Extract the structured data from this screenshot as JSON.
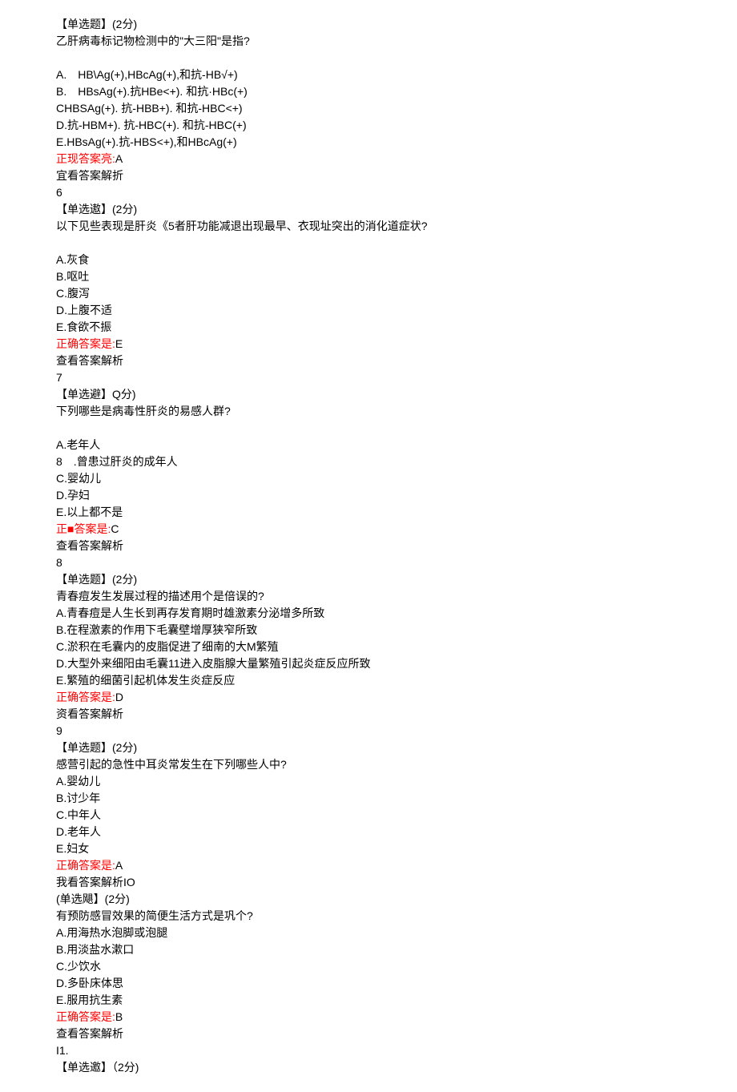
{
  "q5": {
    "header": "【单选题】(2分)",
    "stem": "乙肝病毒标记物检测中的\"大三阳\"是指?",
    "blank": "",
    "optA": "A.　HB\\Ag(+),HBcAg(+),和抗-HB√+)",
    "optB": "B.　HBsAg(+).抗HBe<+). 和抗·HBc(+)",
    "optC": "CHBSAg(+). 抗-HBB+). 和抗-HBC<+)",
    "optD": "D.抗-HBM+). 抗-HBC(+). 和抗-HBC(+)",
    "optE": "E.HBsAg(+).抗-HBS<+),和HBcAg(+)",
    "answerLabel": "正现答案亮:",
    "answerValue": "A",
    "explain": "宜看答案解折",
    "num": "6"
  },
  "q6": {
    "header": "【单选遨】(2分)",
    "stem": "以下见些表现是肝炎《5者肝功能减退出现最早、衣现址突出的消化道症状?",
    "optA": "A.灰食",
    "optB": "B.呕吐",
    "optC": "C.腹泻",
    "optD": "D.上腹不适",
    "optE": "E.食欲不振",
    "answerLabel": "正确答案是:",
    "answerValue": "E",
    "explain": "查看答案解析",
    "num": "7"
  },
  "q7": {
    "header": "【单选避】Q分)",
    "stem": "下列哪些是病毒性肝炎的易感人群?",
    "optA": "A.老年人",
    "optB": "8　.曾患过肝炎的成年人",
    "optC": "C.婴幼儿",
    "optD": "D.孕妇",
    "optE": "E.以上都不是",
    "answerLabelLeft": "正",
    "answerLabelRight": "答案是:",
    "answerValue": "C",
    "explain": "查看答案解析",
    "num": "8"
  },
  "q8": {
    "header": "【单选题】(2分)",
    "stem": "青春痘发生发展过程的描述用个是倍误的?",
    "optA": "A.青春痘是人生长到再存发育期时雄激素分泌增多所致",
    "optB": "B.在程激素的作用下毛囊壁增厚狭窄所致",
    "optC": "C.淤积在毛囊内的皮脂促进了细南的大M繁殖",
    "optD": "D.大型外来细阳由毛囊11进入皮脂腺大量繁殖引起炎症反应所致",
    "optE": "E.繁殖的细菌引起机体发生炎症反应",
    "answerLabel": "正确答案是:",
    "answerValue": "D",
    "explain": "资看答案解析",
    "num": "9"
  },
  "q9": {
    "header": "【单选题】(2分)",
    "stem": "感营引起的急性中耳炎常发生在下列哪些人中?",
    "optA": "A.婴幼儿",
    "optB": "B.讨少年",
    "optC": "C.中年人",
    "optD": "D.老年人",
    "optE": "E.妇女",
    "answerLabel": "正确答案是:",
    "answerValue": "A",
    "explain": "我看答案解析IO"
  },
  "q10": {
    "header": "(单选飓】(2分)",
    "stem": "有预防感冒效果的简便生活方式是巩个?",
    "optA": "A.用海热水泡脚或泡腿",
    "optB": "B.用淡盐水漱口",
    "optC": "C.少饮水",
    "optD": "D.多卧床体思",
    "optE": "E.服用抗生素",
    "answerLabel": "正确答案是:",
    "answerValue": "B",
    "explain": "查看答案解析",
    "num": "I1."
  },
  "q11": {
    "header": "【单选邀】（2分)"
  }
}
